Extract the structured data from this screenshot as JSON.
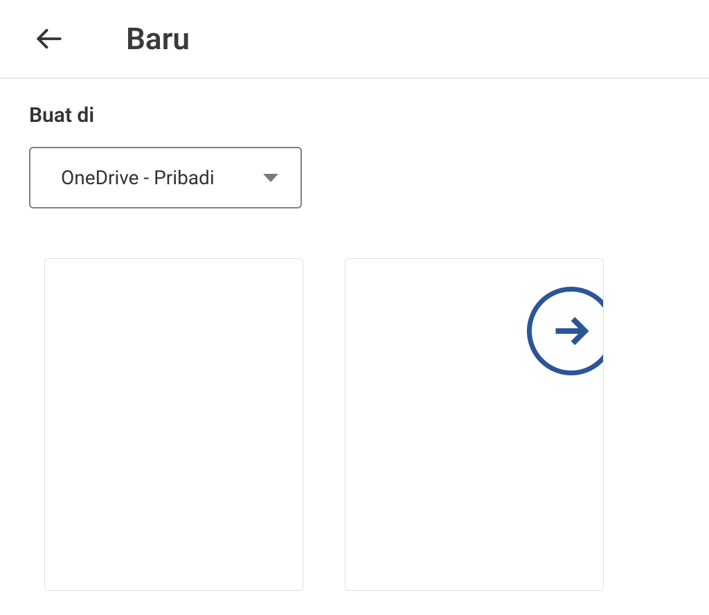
{
  "header": {
    "title": "Baru"
  },
  "content": {
    "section_label": "Buat di",
    "dropdown": {
      "selected": "OneDrive - Pribadi"
    }
  },
  "colors": {
    "accent": "#2a5699"
  }
}
